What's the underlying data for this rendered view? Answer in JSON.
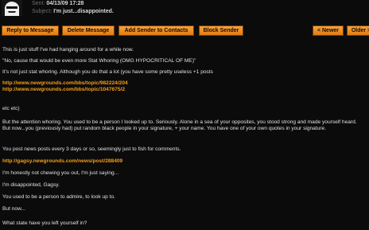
{
  "message": {
    "sent_label": "Sent:",
    "sent_value": "04/13/09 17:28",
    "subject_label": "Subject:",
    "subject_value": "I'm just...disappointed."
  },
  "toolbar": {
    "reply": "Reply to Message",
    "delete": "Delete Message",
    "add_contact": "Add Sender to Contacts",
    "block": "Block Sender",
    "newer": "< Newer",
    "older": "Older >"
  },
  "body": {
    "p1": "This is just stuff I've had hanging around for a while now.",
    "p2": "\"No, cause that would be even more Stat Whoring (OMG HYPOCRITICAL OF ME)\"",
    "p3": "It's not just stat whoring. Although you do that a lot (you have some pretty useless +1 posts",
    "link1": "http://www.newgrounds.com/bbs/topic/982224/204",
    "link2": "http://www.newgrounds.com/bbs/topic/1047675/2",
    "p4": "etc etc)",
    "p5": "But the attention whoring. You used to be a person I looked up to. Seriously. Alone in a sea of your opposites, you stood strong and made yourself heard. But now...you (previously had) put random black people in your signature, + your name. You have one of your own quotes in your signature.",
    "p6": "You post news posts every 3 days or so, seemingly just to fish for comments.",
    "link3": "http://gagsy.newgrounds.com/news/post/288409",
    "p7": "I'm honestly not chewing you out, I'm just saying...",
    "p8": "I'm disappointed, Gagsy.",
    "p9": "You used to be a person to admire, to look up to.",
    "p10": "But now...",
    "p11": "What state have you left yourself in?"
  },
  "colors": {
    "accent": "#f79d1a",
    "background": "#0b0b0b",
    "button": "#e8871f"
  },
  "icons": {
    "avatar": "sender-avatar"
  }
}
